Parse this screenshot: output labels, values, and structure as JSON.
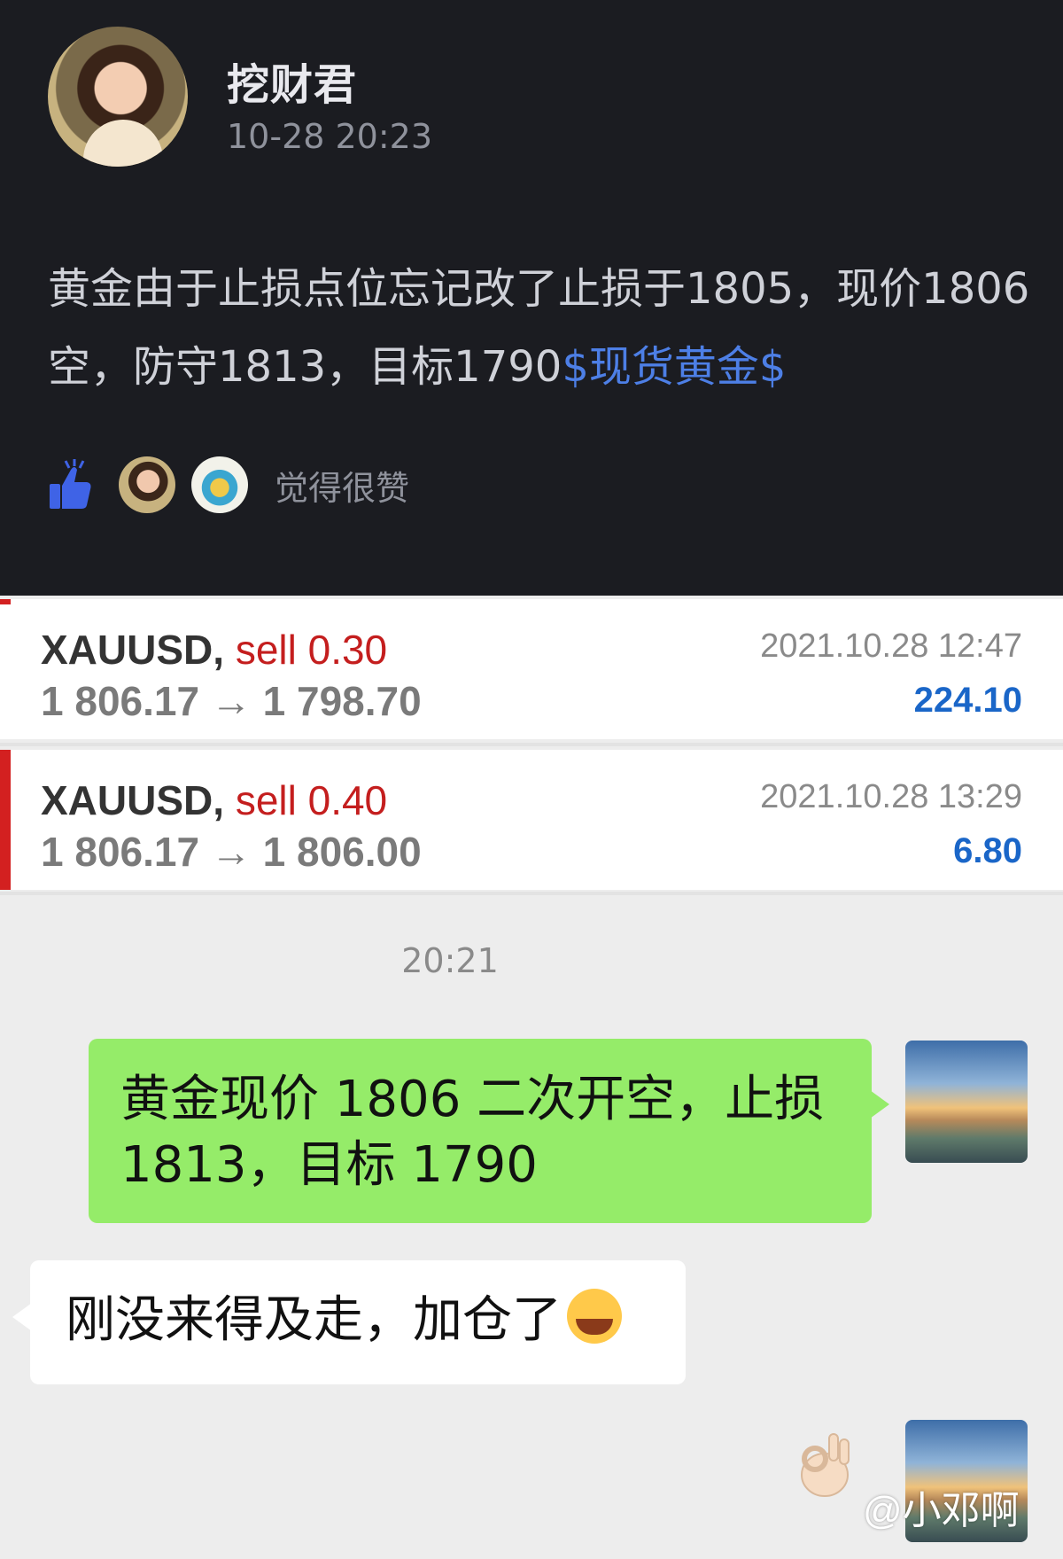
{
  "post": {
    "username": "挖财君",
    "timestamp": "10-28 20:23",
    "text": "黄金由于止损点位忘记改了止损于1805，现价1806空，防守1813，目标1790",
    "tag": "$现货黄金$",
    "likes_label": "觉得很赞"
  },
  "trades": [
    {
      "symbol": "XAUUSD,",
      "side": "sell 0.30",
      "prices": "1 806.17 → 1 798.70",
      "datetime": "2021.10.28 12:47",
      "profit": "224.10"
    },
    {
      "symbol": "XAUUSD,",
      "side": "sell 0.40",
      "prices": "1 806.17 → 1 806.00",
      "datetime": "2021.10.28 13:29",
      "profit": "6.80"
    }
  ],
  "chat": {
    "time": "20:21",
    "outgoing_message": "黄金现价 1806 二次开空，止损 1813，目标 1790",
    "incoming_message": "刚没来得及走，加仓了"
  },
  "watermark": "@小邓啊",
  "colors": {
    "post_bg": "#1b1c21",
    "tag": "#4d7fe6",
    "sell": "#c41e1e",
    "profit": "#1a66c8",
    "bubble_out": "#95ec69"
  }
}
